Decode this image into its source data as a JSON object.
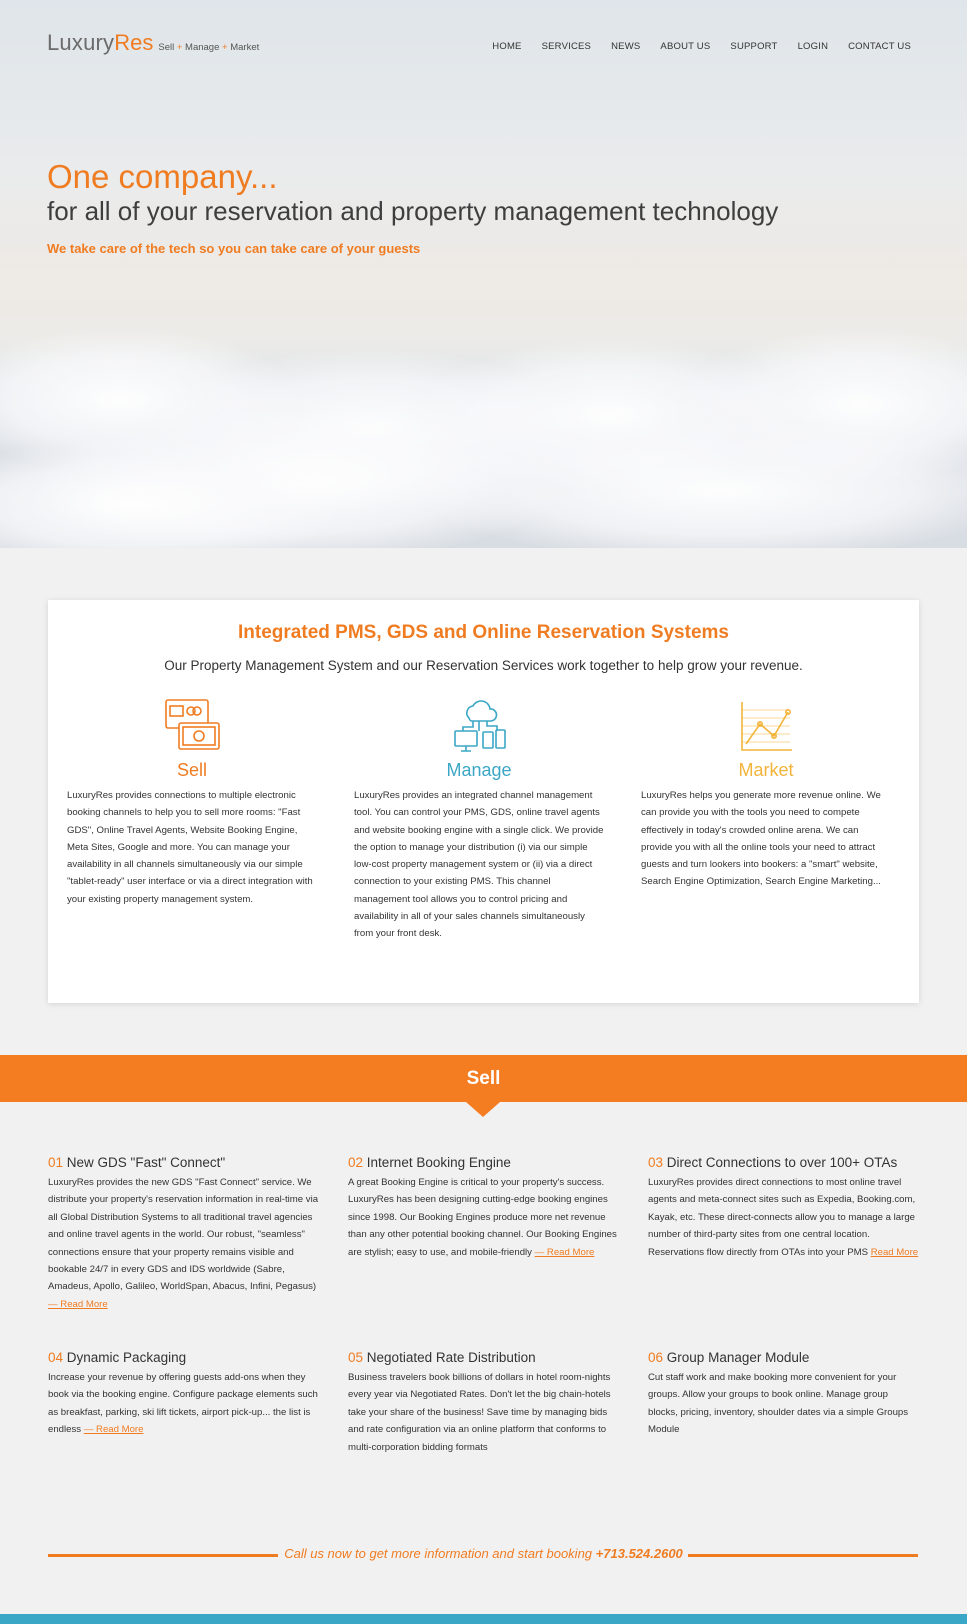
{
  "header": {
    "logo_main": "Luxury",
    "logo_accent": "Res",
    "logo_tag_1": "Sell",
    "logo_tag_2": "Manage",
    "logo_tag_3": "Market",
    "plus": "+"
  },
  "nav": [
    "HOME",
    "SERVICES",
    "NEWS",
    "ABOUT US",
    "SUPPORT",
    "LOGIN",
    "CONTACT US"
  ],
  "hero": {
    "title": "One company...",
    "subtitle": "for all of your reservation and property management technology",
    "tagline": "We take care of the tech so you can take care of your guests"
  },
  "intro": {
    "title": "Integrated PMS, GDS and Online Reservation Systems",
    "subtitle": "Our Property Management System and our Reservation Services work together to help grow your revenue.",
    "columns": [
      {
        "icon": "money-icon",
        "heading": "Sell",
        "color": "#f07c22",
        "body": "LuxuryRes provides connections to multiple electronic booking channels to help you to sell more rooms: \"Fast GDS\", Online Travel Agents, Website Booking Engine, Meta Sites, Google and more. You can manage your availability in all channels simultaneously via our simple \"tablet-ready\" user interface or via a direct integration with your existing property management system."
      },
      {
        "icon": "cloud-devices-icon",
        "heading": "Manage",
        "color": "#3ba7c6",
        "body": "LuxuryRes provides an integrated channel management tool. You can control your PMS, GDS, online travel agents and website booking engine with a single click. We provide the option to manage your distribution (i) via our simple low-cost property management system or (ii) via a direct connection to your existing PMS. This channel management tool allows you to control pricing and availability in all of your sales channels simultaneously from your front desk."
      },
      {
        "icon": "line-chart-icon",
        "heading": "Market",
        "color": "#f2b43a",
        "body": "LuxuryRes helps you generate more revenue online. We can provide you with the tools you need to compete effectively in today's crowded online arena. We can provide you with all the online tools your need to attract guests and turn lookers into bookers: a \"smart\" website, Search Engine Optimization, Search Engine Marketing..."
      }
    ]
  },
  "band": {
    "label": "Sell"
  },
  "features": [
    {
      "num": "01",
      "title": "New GDS \"Fast\" Connect\"",
      "body": "LuxuryRes provides the new GDS \"Fast Connect\" service. We distribute your property's reservation information in real-time via all Global Distribution Systems to all traditional travel agencies and online travel agents in the world. Our robust, \"seamless\" connections ensure that your property remains visible and bookable 24/7 in every GDS and IDS worldwide (Sabre, Amadeus, Apollo, Galileo, WorldSpan, Abacus, Infini, Pegasus)",
      "more": "— Read More"
    },
    {
      "num": "02",
      "title": "Internet Booking Engine",
      "body": "A great Booking Engine is critical to your property's success. LuxuryRes has been designing cutting-edge booking engines since 1998. Our Booking Engines produce more net revenue than any other potential booking channel. Our Booking Engines are stylish; easy to use, and mobile-friendly",
      "more": "— Read More"
    },
    {
      "num": "03",
      "title": "Direct Connections to over 100+ OTAs",
      "body": "LuxuryRes provides direct connections to most online travel agents and meta-connect sites such as Expedia, Booking.com, Kayak, etc. These direct-connects allow you to manage a large number of third-party sites from one central location. Reservations flow directly from OTAs into your PMS",
      "more": "Read More"
    },
    {
      "num": "04",
      "title": "Dynamic Packaging",
      "body": "Increase your revenue by offering guests add-ons when they book via the booking engine. Configure package elements such as breakfast, parking, ski lift tickets, airport pick-up... the list is endless",
      "more": "— Read More"
    },
    {
      "num": "05",
      "title": "Negotiated Rate Distribution",
      "body": "Business travelers book billions of dollars in hotel room-nights every year via Negotiated Rates. Don't let the big chain-hotels take your share of the business! Save time by managing bids and rate configuration via an online platform that conforms to multi-corporation bidding formats",
      "more": ""
    },
    {
      "num": "06",
      "title": "Group Manager Module",
      "body": "Cut staff work and make booking more convenient for your groups. Allow your groups to book online. Manage group blocks, pricing, inventory, shoulder dates via a simple Groups Module",
      "more": ""
    }
  ],
  "call": {
    "text": "Call us now to get more information and start booking",
    "phone": "+713.524.2600"
  },
  "colors": {
    "accent": "#f07c22",
    "band": "#f47c21",
    "blue": "#3ba7c6",
    "yellow": "#f2b43a"
  }
}
